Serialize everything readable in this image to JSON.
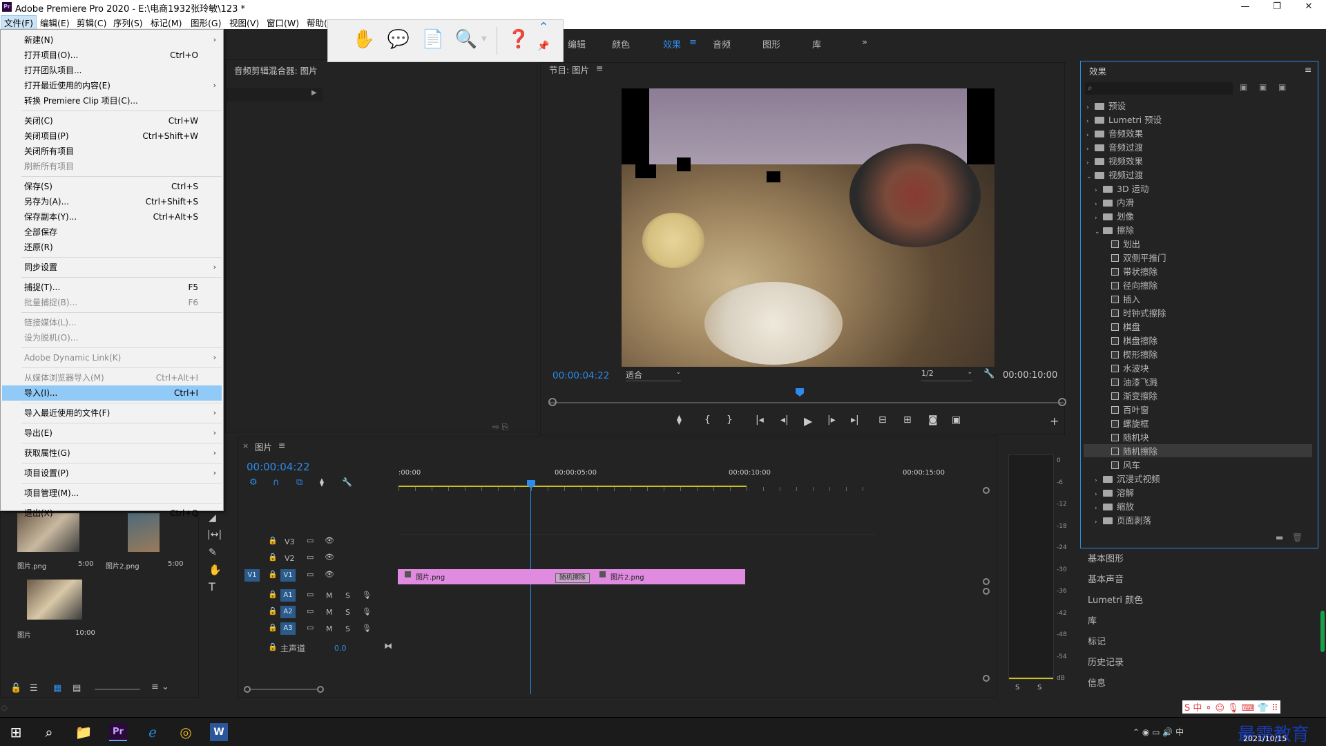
{
  "titlebar": {
    "text": "Adobe Premiere Pro 2020 - E:\\电商1932张玲敏\\123 *"
  },
  "menubar": {
    "items": [
      "文件(F)",
      "编辑(E)",
      "剪辑(C)",
      "序列(S)",
      "标记(M)",
      "图形(G)",
      "视图(V)",
      "窗口(W)",
      "帮助(H)"
    ]
  },
  "workspace_tabs": [
    {
      "label": "编辑",
      "selected": false
    },
    {
      "label": "颜色",
      "selected": false
    },
    {
      "label": "效果",
      "selected": true
    },
    {
      "label": "音频",
      "selected": false
    },
    {
      "label": "图形",
      "selected": false
    },
    {
      "label": "库",
      "selected": false
    }
  ],
  "file_menu": [
    {
      "label": "新建(N)",
      "shortcut": "",
      "submenu": true,
      "disabled": false
    },
    {
      "label": "打开项目(O)...",
      "shortcut": "Ctrl+O",
      "submenu": false,
      "disabled": false
    },
    {
      "label": "打开团队项目...",
      "shortcut": "",
      "submenu": false,
      "disabled": false
    },
    {
      "label": "打开最近使用的内容(E)",
      "shortcut": "",
      "submenu": true,
      "disabled": false
    },
    {
      "label": "转换 Premiere Clip 项目(C)...",
      "shortcut": "",
      "submenu": false,
      "disabled": false
    },
    {
      "label": "关闭(C)",
      "shortcut": "Ctrl+W",
      "submenu": false,
      "disabled": false
    },
    {
      "label": "关闭项目(P)",
      "shortcut": "Ctrl+Shift+W",
      "submenu": false,
      "disabled": false
    },
    {
      "label": "关闭所有项目",
      "shortcut": "",
      "submenu": false,
      "disabled": false
    },
    {
      "label": "刷新所有项目",
      "shortcut": "",
      "submenu": false,
      "disabled": true
    },
    {
      "label": "保存(S)",
      "shortcut": "Ctrl+S",
      "submenu": false,
      "disabled": false
    },
    {
      "label": "另存为(A)...",
      "shortcut": "Ctrl+Shift+S",
      "submenu": false,
      "disabled": false
    },
    {
      "label": "保存副本(Y)...",
      "shortcut": "Ctrl+Alt+S",
      "submenu": false,
      "disabled": false
    },
    {
      "label": "全部保存",
      "shortcut": "",
      "submenu": false,
      "disabled": false
    },
    {
      "label": "还原(R)",
      "shortcut": "",
      "submenu": false,
      "disabled": false
    },
    {
      "label": "同步设置",
      "shortcut": "",
      "submenu": true,
      "disabled": false
    },
    {
      "label": "捕捉(T)...",
      "shortcut": "F5",
      "submenu": false,
      "disabled": false
    },
    {
      "label": "批量捕捉(B)...",
      "shortcut": "F6",
      "submenu": false,
      "disabled": true
    },
    {
      "label": "链接媒体(L)...",
      "shortcut": "",
      "submenu": false,
      "disabled": true
    },
    {
      "label": "设为脱机(O)...",
      "shortcut": "",
      "submenu": false,
      "disabled": true
    },
    {
      "label": "Adobe Dynamic Link(K)",
      "shortcut": "",
      "submenu": true,
      "disabled": true
    },
    {
      "label": "从媒体浏览器导入(M)",
      "shortcut": "Ctrl+Alt+I",
      "submenu": false,
      "disabled": true
    },
    {
      "label": "导入(I)...",
      "shortcut": "Ctrl+I",
      "submenu": false,
      "disabled": false,
      "highlighted": true
    },
    {
      "label": "导入最近使用的文件(F)",
      "shortcut": "",
      "submenu": true,
      "disabled": false
    },
    {
      "label": "导出(E)",
      "shortcut": "",
      "submenu": true,
      "disabled": false
    },
    {
      "label": "获取属性(G)",
      "shortcut": "",
      "submenu": true,
      "disabled": false
    },
    {
      "label": "项目设置(P)",
      "shortcut": "",
      "submenu": true,
      "disabled": false
    },
    {
      "label": "项目管理(M)...",
      "shortcut": "",
      "submenu": false,
      "disabled": false
    },
    {
      "label": "退出(X)",
      "shortcut": "Ctrl+Q",
      "submenu": false,
      "disabled": false
    }
  ],
  "source_panel": {
    "title": "音频剪辑混合器: 图片"
  },
  "program": {
    "title": "节目: 图片",
    "timecode": "00:00:04:22",
    "fit": "适合",
    "quality": "1/2",
    "duration": "00:00:10:00"
  },
  "effects": {
    "title": "效果",
    "tree": [
      {
        "label": "预设",
        "level": 0,
        "type": "bin"
      },
      {
        "label": "Lumetri 预设",
        "level": 0,
        "type": "bin"
      },
      {
        "label": "音频效果",
        "level": 0,
        "type": "folder"
      },
      {
        "label": "音频过渡",
        "level": 0,
        "type": "folder"
      },
      {
        "label": "视频效果",
        "level": 0,
        "type": "folder"
      },
      {
        "label": "视频过渡",
        "level": 0,
        "type": "folder",
        "open": true
      },
      {
        "label": "3D 运动",
        "level": 1,
        "type": "folder"
      },
      {
        "label": "内滑",
        "level": 1,
        "type": "folder"
      },
      {
        "label": "划像",
        "level": 1,
        "type": "folder"
      },
      {
        "label": "擦除",
        "level": 1,
        "type": "folder",
        "open": true
      },
      {
        "label": "划出",
        "level": 2,
        "type": "effect"
      },
      {
        "label": "双侧平推门",
        "level": 2,
        "type": "effect"
      },
      {
        "label": "带状擦除",
        "level": 2,
        "type": "effect"
      },
      {
        "label": "径向擦除",
        "level": 2,
        "type": "effect"
      },
      {
        "label": "插入",
        "level": 2,
        "type": "effect"
      },
      {
        "label": "时钟式擦除",
        "level": 2,
        "type": "effect"
      },
      {
        "label": "棋盘",
        "level": 2,
        "type": "effect"
      },
      {
        "label": "棋盘擦除",
        "level": 2,
        "type": "effect"
      },
      {
        "label": "楔形擦除",
        "level": 2,
        "type": "effect"
      },
      {
        "label": "水波块",
        "level": 2,
        "type": "effect"
      },
      {
        "label": "油漆飞溅",
        "level": 2,
        "type": "effect"
      },
      {
        "label": "渐变擦除",
        "level": 2,
        "type": "effect"
      },
      {
        "label": "百叶窗",
        "level": 2,
        "type": "effect"
      },
      {
        "label": "螺旋框",
        "level": 2,
        "type": "effect"
      },
      {
        "label": "随机块",
        "level": 2,
        "type": "effect"
      },
      {
        "label": "随机擦除",
        "level": 2,
        "type": "effect",
        "selected": true
      },
      {
        "label": "风车",
        "level": 2,
        "type": "effect"
      },
      {
        "label": "沉浸式视频",
        "level": 1,
        "type": "folder"
      },
      {
        "label": "溶解",
        "level": 1,
        "type": "folder"
      },
      {
        "label": "缩放",
        "level": 1,
        "type": "folder"
      },
      {
        "label": "页面剥落",
        "level": 1,
        "type": "folder"
      }
    ]
  },
  "side_panels": [
    "基本图形",
    "基本声音",
    "Lumetri 颜色",
    "库",
    "标记",
    "历史记录",
    "信息"
  ],
  "project_items": [
    {
      "name": "图片.png",
      "duration": "5:00"
    },
    {
      "name": "图片2.png",
      "duration": "5:00"
    },
    {
      "name": "图片",
      "duration": "10:00"
    }
  ],
  "timeline": {
    "tab": "图片",
    "timecode": "00:00:04:22",
    "ruler": [
      ":00:00",
      "00:00:05:00",
      "00:00:10:00",
      "00:00:15:00"
    ],
    "video_tracks": [
      "V3",
      "V2",
      "V1"
    ],
    "audio_tracks": [
      "A1",
      "A2",
      "A3"
    ],
    "master": "主声道",
    "master_value": "0.0",
    "clips": [
      {
        "name": "图片.png"
      },
      {
        "name": "图片2.png"
      }
    ],
    "transition": "随机擦除"
  },
  "meter_ticks": [
    "0",
    "-6",
    "-12",
    "-18",
    "-24",
    "-30",
    "-36",
    "-42",
    "-48",
    "-54",
    "dB"
  ],
  "taskbar": {
    "date": "2021/10/15",
    "watermark": "最需教育"
  },
  "colors": {
    "accent": "#2d8ceb",
    "clip": "#e08ae0",
    "menu_highlight": "#91c9f7"
  }
}
